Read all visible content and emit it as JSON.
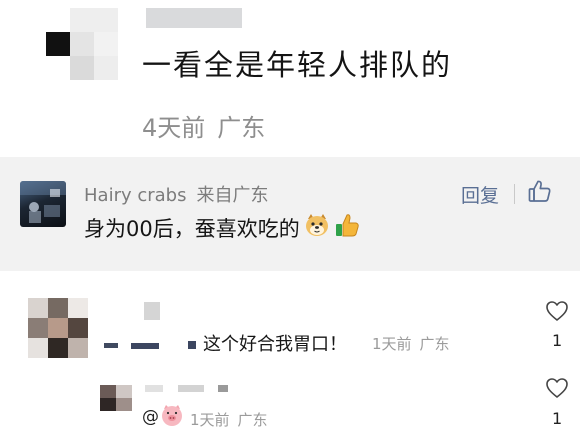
{
  "top_comment": {
    "text": "一看全是年轻人排队的",
    "time": "4天前",
    "location": "广东"
  },
  "highlighted_comment": {
    "username": "Hairy crabs",
    "from_location": "来自广东",
    "text": "身为00后，蚕喜欢吃的",
    "emojis": [
      "doge-emoji",
      "thumbs-up-emoji"
    ],
    "reply_label": "回复",
    "like_icon": "thumbs-up-icon"
  },
  "replies": [
    {
      "text": "这个好合我胃口！",
      "time": "1天前",
      "location": "广东",
      "like_count": "1",
      "like_icon": "heart-icon"
    },
    {
      "mention": "@",
      "sticker": "pig-face-sticker",
      "time": "1天前",
      "location": "广东",
      "like_count": "1",
      "like_icon": "heart-icon"
    }
  ],
  "colors": {
    "highlight_bg": "#f2f2f2",
    "reply_link": "#5a6f94",
    "meta_text": "#8e8e8e"
  }
}
